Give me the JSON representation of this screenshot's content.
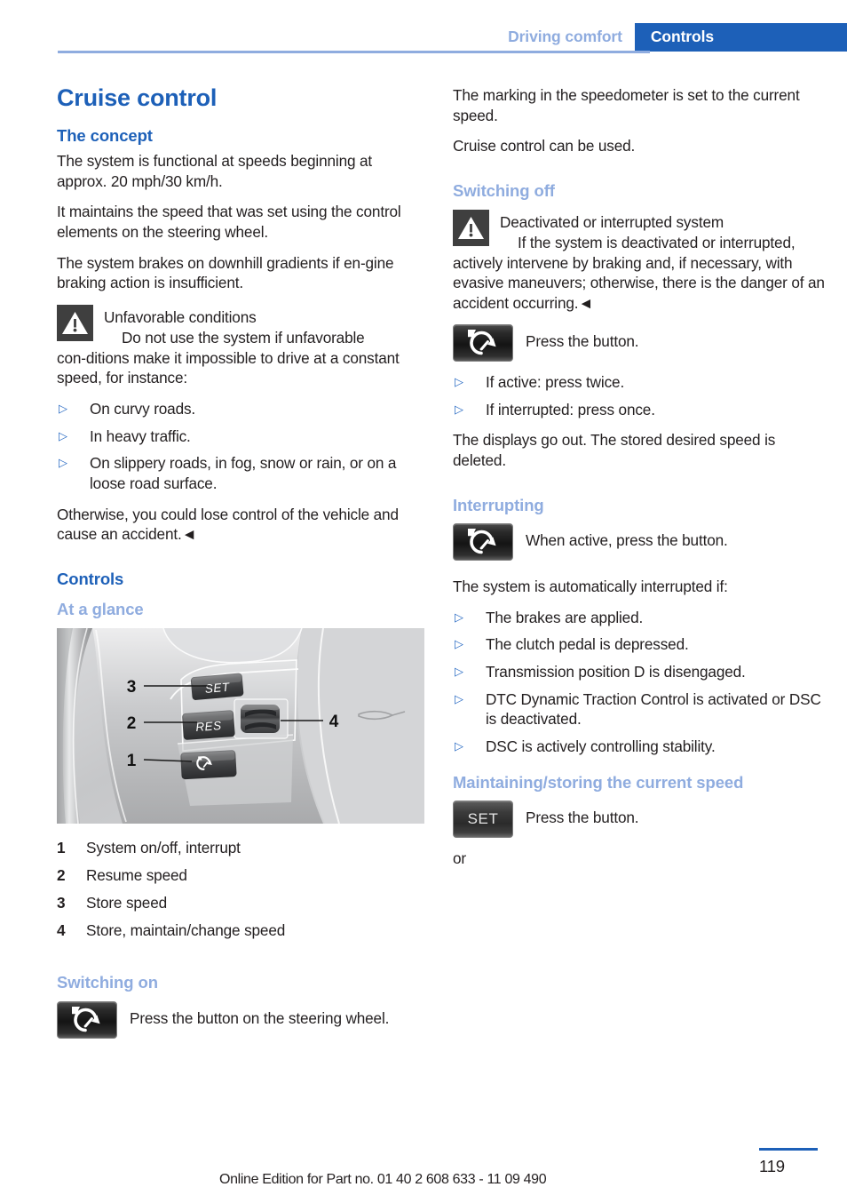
{
  "header": {
    "breadcrumb_inactive": "Driving comfort",
    "breadcrumb_active": "Controls"
  },
  "colors": {
    "accent_blue": "#1d60b8",
    "light_blue": "#8facdf",
    "text": "#231f20"
  },
  "left_column": {
    "title": "Cruise control",
    "concept": {
      "heading": "The concept",
      "paragraphs": [
        "The system is functional at speeds beginning at approx. 20 mph/30 km/h.",
        "It maintains the speed that was set using the control elements on the steering wheel.",
        "The system brakes on downhill gradients if en‑gine braking action is insufficient."
      ]
    },
    "warning": {
      "icon": "warning-triangle-icon",
      "title": "Unfavorable conditions",
      "body": "Do not use the system if unfavorable con‑ditions make it impossible to drive at a constant speed, for instance:",
      "bullets": [
        "On curvy roads.",
        "In heavy traffic.",
        "On slippery roads, in fog, snow or rain, or on a loose road surface."
      ],
      "closing": "Otherwise, you could lose control of the vehicle and cause an accident.◄"
    },
    "controls_heading": "Controls",
    "at_a_glance_heading": "At a glance",
    "figure": {
      "alt": "Steering wheel cruise control buttons",
      "callouts": [
        "1",
        "2",
        "3",
        "4"
      ],
      "button_labels": [
        "SET",
        "RES"
      ]
    },
    "legend": [
      {
        "num": "1",
        "text": "System on/off, interrupt"
      },
      {
        "num": "2",
        "text": "Resume speed"
      },
      {
        "num": "3",
        "text": "Store speed"
      },
      {
        "num": "4",
        "text": "Store, maintain/change speed"
      }
    ],
    "switching_on": {
      "heading": "Switching on",
      "button_icon": "cruise-control-button-icon",
      "instruction": "Press the button on the steering wheel."
    }
  },
  "right_column": {
    "intro_paragraphs": [
      "The marking in the speedometer is set to the current speed.",
      "Cruise control can be used."
    ],
    "switching_off": {
      "heading": "Switching off",
      "warning": {
        "icon": "warning-triangle-icon",
        "title": "Deactivated or interrupted system",
        "body": "If the system is deactivated or interrupted, actively intervene by braking and, if necessary, with evasive maneuvers; otherwise, there is the danger of an accident occurring.◄"
      },
      "button_icon": "cruise-control-button-icon",
      "instruction": "Press the button.",
      "bullets": [
        "If active: press twice.",
        "If interrupted: press once."
      ],
      "closing": "The displays go out. The stored desired speed is deleted."
    },
    "interrupting": {
      "heading": "Interrupting",
      "button_icon": "cruise-control-button-icon",
      "instruction": "When active, press the button.",
      "lead_in": "The system is automatically interrupted if:",
      "bullets": [
        "The brakes are applied.",
        "The clutch pedal is depressed.",
        "Transmission position D is disengaged.",
        "DTC Dynamic Traction Control is activated or DSC is deactivated.",
        "DSC is actively controlling stability."
      ]
    },
    "maintaining": {
      "heading": "Maintaining/storing the current speed",
      "button_label": "SET",
      "instruction": "Press the button.",
      "or_text": "or"
    }
  },
  "footer": {
    "note": "Online Edition for Part no. 01 40 2 608 633 - 11 09 490",
    "page_number": "119"
  }
}
